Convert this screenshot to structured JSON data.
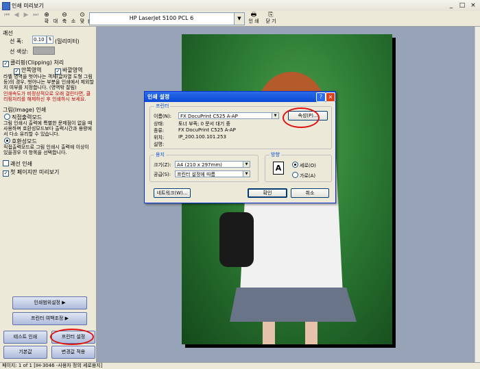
{
  "window": {
    "title": "인쇄 미리보기",
    "min": "_",
    "max": "□",
    "close": "×"
  },
  "toolbar": {
    "zoom_in": "확",
    "zoom_in2": "대",
    "zoom_out": "축",
    "zoom_out2": "소",
    "fit": "맞",
    "fit2": "춤",
    "printer_name": "HP LaserJet 5100 PCL 6",
    "print": "인 쇄",
    "close": "닫 기"
  },
  "left": {
    "line_section": "괘선",
    "line_width_label": "선 폭:",
    "line_width_value": "0.10",
    "line_width_unit": "(밀리미터)",
    "line_color_label": "선 색상:",
    "clipping_label": "클리핑(Clipping) 처리",
    "inner_area": "안쪽영역",
    "outer_area": "바깥영역",
    "clipping_note": "라벨 영역을 벗어나는 객체(글자열 도형 그림 등)의 경우, 벗어나는 부분을 인쇄에서 제외할지 여부를 지정합니다. (영역밖 잘림)",
    "clipping_warning": "인쇄속도가 비정상적으로 오래 걸린다면, 클리핑처리를 해제하신 후 인쇄하시 보세요.",
    "image_section": "그림(Image) 인쇄",
    "direct_mode": "직접출력모드",
    "direct_note": "그림 인쇄시 출력에 특별한 문제점이 없을 때 사용하며 호환성모드보다 출력시간과 용량에서 다소 유리할 수 있습니다.",
    "compat_mode": "호환성모드",
    "compat_note": "직접출력모드로 그림 인쇄시 출력에 이상이 있을경우 이 항목을 선택합니다.",
    "line_print": "괘선 인쇄",
    "first_page_only": "첫 페이지만 미리보기",
    "print_range_btn": "인쇄범위설정",
    "printer_margin_btn": "프린터 여백조정",
    "test_print_btn": "테스트 인쇄",
    "printer_setup_btn": "프린터 설정",
    "default_btn": "기본값",
    "apply_btn": "변경값 적용"
  },
  "status": {
    "text": "페이지: 1 of 1 [IH-3046 -사용자 정의 세로용지]"
  },
  "dialog": {
    "title": "인쇄 설정",
    "help": "?",
    "close": "×",
    "printer_group": "프린터",
    "name_label": "이름(N):",
    "name_value": "FX DocuPrint C525 A-AP",
    "properties_btn": "속성(P)...",
    "status_label": "상태:",
    "status_value": "토너 부족; 0 문서 대기 중",
    "type_label": "종류:",
    "type_value": "FX DocuPrint C525 A-AP",
    "where_label": "위치:",
    "where_value": "IP_200.100.101.253",
    "comment_label": "설명:",
    "paper_group": "용지",
    "size_label": "크기(Z):",
    "size_value": "A4 (210 x 297mm)",
    "source_label": "공급(S):",
    "source_value": "프린터 설정에 따름",
    "orientation_group": "방향",
    "portrait": "세로(O)",
    "landscape": "가로(A)",
    "network_btn": "네트워크(W)...",
    "ok_btn": "확인",
    "cancel_btn": "취소"
  },
  "colors": {
    "preview_bg": "#97a3b7",
    "dialog_title": "#0a4ad6",
    "annotation": "#e01010"
  }
}
